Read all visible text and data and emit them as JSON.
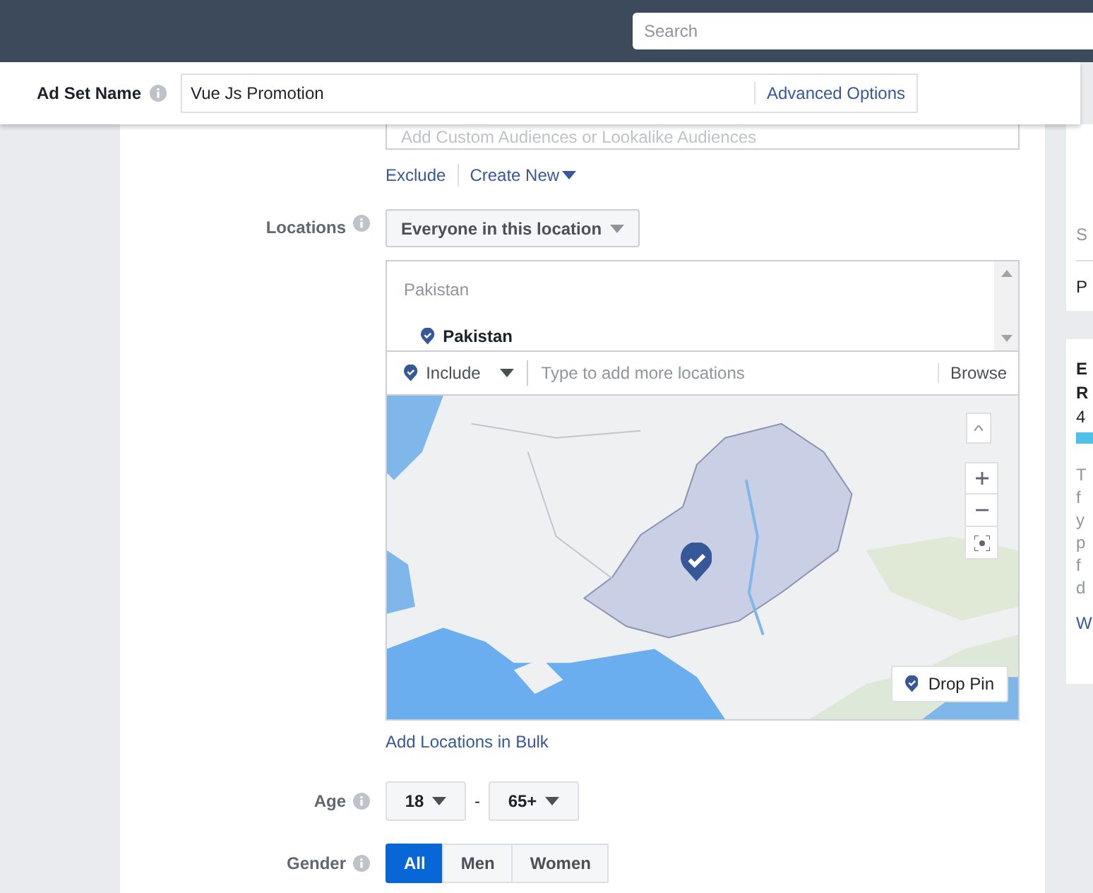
{
  "top_bar": {
    "search": {
      "placeholder": "Search"
    }
  },
  "ad_set_name": {
    "label": "Ad Set Name",
    "value": "Vue Js Promotion",
    "link": "Advanced Options"
  },
  "custom_audiences": {
    "placeholder": "Add Custom Audiences or Lookalike Audiences",
    "links": [
      {
        "label": "Exclude",
        "kind": "link"
      },
      {
        "label": "Create New",
        "kind": "dropdown"
      }
    ]
  },
  "locations": {
    "label": "Locations",
    "type_select": "Everyone in this location",
    "group_heading": "Pakistan",
    "selected_locations": [
      "Pakistan"
    ],
    "mode": "Include",
    "search_placeholder": "Type to add more locations",
    "browse": "Browse",
    "map": {
      "kind": "picture",
      "drop_pin": "Drop Pin"
    },
    "bulk_link": "Add Locations in Bulk"
  },
  "age": {
    "label": "Age",
    "min": "18",
    "separator": "-",
    "max": "65+"
  },
  "gender": {
    "label": "Gender",
    "options": [
      {
        "label": "All",
        "selected": true
      },
      {
        "label": "Men",
        "selected": false
      },
      {
        "label": "Women",
        "selected": false
      }
    ]
  },
  "side_cards": [
    {
      "lines": [
        {
          "kind": "muted",
          "text": "S"
        },
        {
          "kind": "divider"
        },
        {
          "kind": "plain",
          "text": "P"
        }
      ]
    },
    {
      "lines": [
        {
          "kind": "title",
          "text": "E"
        },
        {
          "kind": "title",
          "text": "R"
        },
        {
          "kind": "plain",
          "text": "4"
        },
        {
          "kind": "bar"
        },
        {
          "kind": "muted",
          "text": "T"
        },
        {
          "kind": "muted",
          "text": "f"
        },
        {
          "kind": "muted",
          "text": "y"
        },
        {
          "kind": "muted",
          "text": "p"
        },
        {
          "kind": "muted",
          "text": "f"
        },
        {
          "kind": "muted",
          "text": "d"
        },
        {
          "kind": "link",
          "text": "W"
        }
      ]
    }
  ]
}
